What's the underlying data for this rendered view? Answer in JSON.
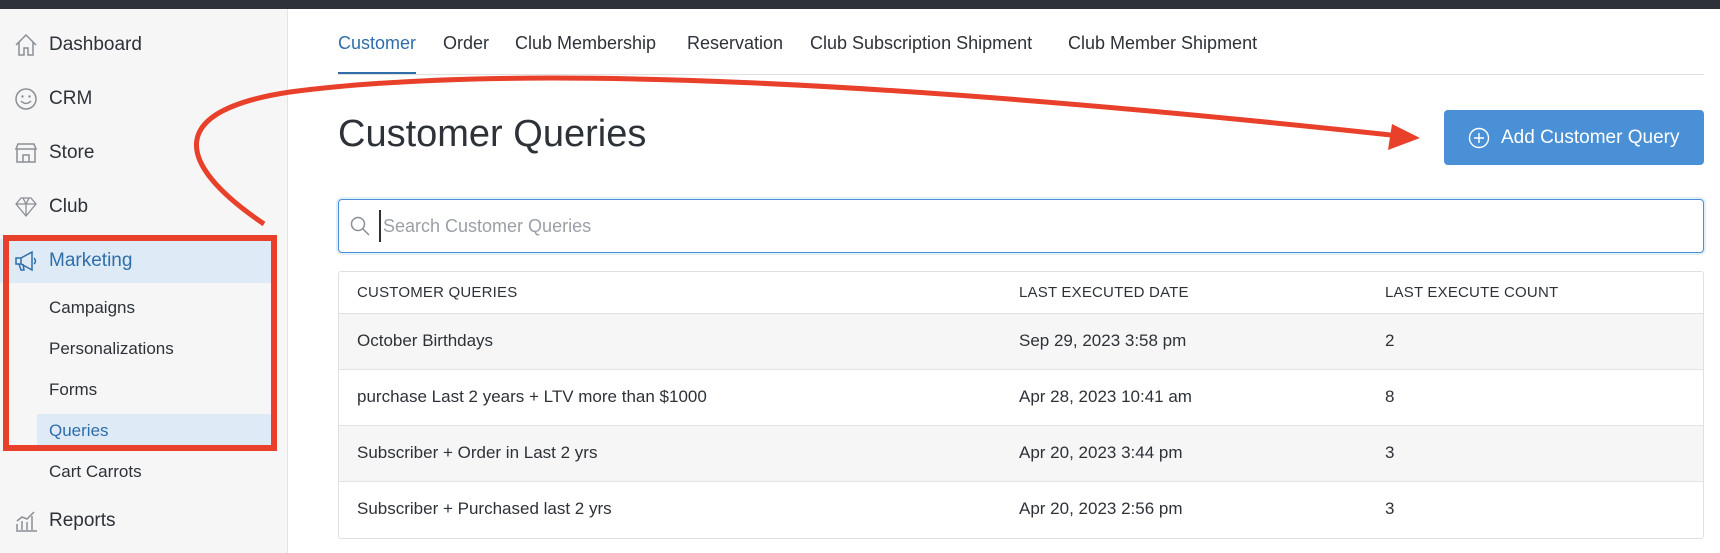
{
  "colors": {
    "accent": "#2f6ea8",
    "button": "#4a90d6",
    "annotation": "#e8402a",
    "active_bg": "#deebf7"
  },
  "sidebar": {
    "items": [
      {
        "label": "Dashboard",
        "icon": "home-icon"
      },
      {
        "label": "CRM",
        "icon": "smiley-icon"
      },
      {
        "label": "Store",
        "icon": "store-icon"
      },
      {
        "label": "Club",
        "icon": "diamond-icon"
      },
      {
        "label": "Marketing",
        "icon": "megaphone-icon"
      }
    ],
    "marketing_sub": [
      "Campaigns",
      "Personalizations",
      "Forms",
      "Queries",
      "Cart Carrots"
    ],
    "reports": {
      "label": "Reports",
      "icon": "bar-chart-icon"
    }
  },
  "tabs": [
    "Customer",
    "Order",
    "Club Membership",
    "Reservation",
    "Club Subscription Shipment",
    "Club Member Shipment"
  ],
  "page_title": "Customer Queries",
  "add_button_label": "Add Customer Query",
  "search": {
    "placeholder": "Search Customer Queries",
    "value": ""
  },
  "table": {
    "headers": [
      "CUSTOMER QUERIES",
      "LAST EXECUTED DATE",
      "LAST EXECUTE COUNT"
    ],
    "rows": [
      [
        "October Birthdays",
        "Sep 29, 2023 3:58 pm",
        "2"
      ],
      [
        "purchase Last 2 years + LTV more than $1000",
        "Apr 28, 2023 10:41 am",
        "8"
      ],
      [
        "Subscriber + Order in Last 2 yrs",
        "Apr 20, 2023 3:44 pm",
        "3"
      ],
      [
        "Subscriber + Purchased last 2 yrs",
        "Apr 20, 2023 2:56 pm",
        "3"
      ]
    ]
  }
}
